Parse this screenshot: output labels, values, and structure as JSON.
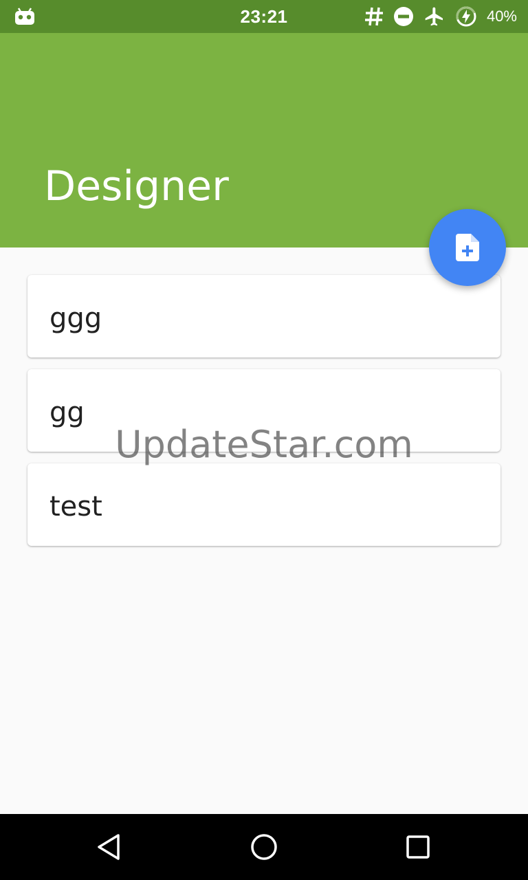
{
  "status_bar": {
    "time": "23:21",
    "battery_percent": "40%",
    "icons": [
      "android-debug-icon",
      "hash-icon",
      "do-not-disturb-icon",
      "airplane-mode-icon",
      "battery-charging-icon"
    ]
  },
  "app_bar": {
    "title": "Designer",
    "color": "#7cb342"
  },
  "fab": {
    "icon": "new-document-icon",
    "color": "#4285f4"
  },
  "list": {
    "items": [
      {
        "label": "ggg"
      },
      {
        "label": "gg"
      },
      {
        "label": "test"
      }
    ]
  },
  "watermark": "UpdateStar.com",
  "nav_bar": {
    "icons": [
      "back-icon",
      "home-icon",
      "recents-icon"
    ]
  }
}
